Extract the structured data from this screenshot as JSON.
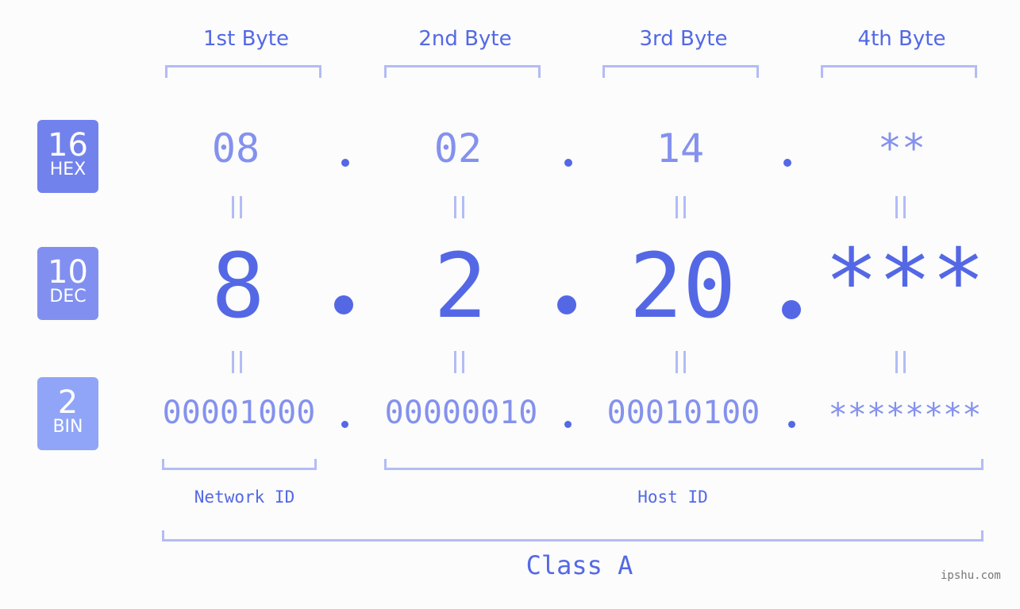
{
  "bytes": [
    {
      "header": "1st Byte",
      "hex": "08",
      "dec": "8",
      "bin": "00001000"
    },
    {
      "header": "2nd Byte",
      "hex": "02",
      "dec": "2",
      "bin": "00000010"
    },
    {
      "header": "3rd Byte",
      "hex": "14",
      "dec": "20",
      "bin": "00010100"
    },
    {
      "header": "4th Byte",
      "hex": "**",
      "dec": "***",
      "bin": "********"
    }
  ],
  "bases": {
    "hex": {
      "num": "16",
      "label": "HEX",
      "color": "#7282ec"
    },
    "dec": {
      "num": "10",
      "label": "DEC",
      "color": "#8190f0"
    },
    "bin": {
      "num": "2",
      "label": "BIN",
      "color": "#90a5f7"
    }
  },
  "segments": {
    "network": "Network ID",
    "host": "Host ID",
    "class": "Class A"
  },
  "watermark": "ipshu.com",
  "colors": {
    "accent": "#5468e6",
    "light": "#8491ee",
    "bracket": "#b3bcf5"
  }
}
